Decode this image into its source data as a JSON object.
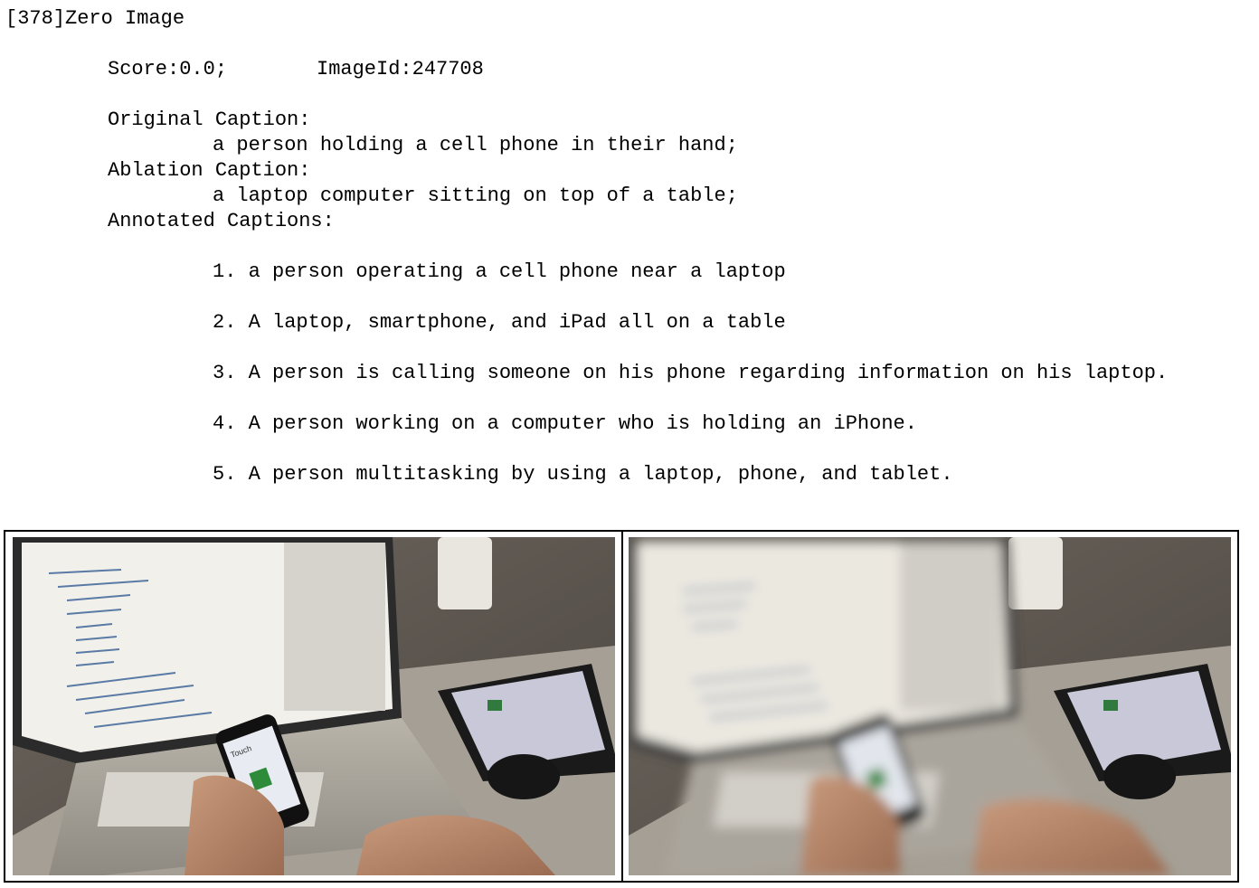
{
  "header": {
    "title": "[378]Zero Image"
  },
  "meta": {
    "score_text": "Score:0.0;",
    "image_id_text": "ImageId:247708"
  },
  "captions": {
    "original_label": "Original Caption:",
    "original_text": "a person holding a cell phone in their hand;",
    "ablation_label": "Ablation Caption:",
    "ablation_text": "a laptop computer sitting on top of a table;",
    "annotated_label": "Annotated Captions:",
    "annotated": [
      "1. a person operating a cell phone near a laptop",
      "2. A laptop, smartphone, and iPad all on a table",
      "3. A person is calling someone on his phone regarding information on his laptop.",
      "4. A person working on a computer who is holding an iPhone.",
      "5. A person multitasking by using a laptop, phone, and tablet."
    ]
  },
  "images": {
    "left": {
      "kind": "original photo",
      "phone_screen_heading": "Touch"
    },
    "right": {
      "kind": "ablated (blurred) photo"
    }
  }
}
